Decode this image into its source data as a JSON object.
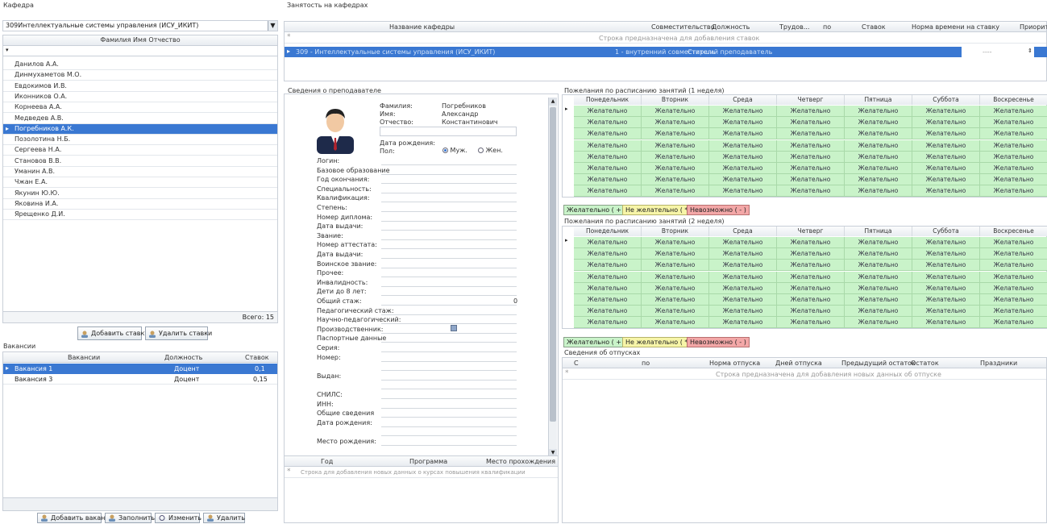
{
  "left": {
    "kafedra_title": "Кафедра",
    "kafedra_value": "309Интеллектуальные системы управления (ИСУ_ИКИТ)",
    "fio_header": "Фамилия Имя Отчество",
    "teachers": [
      "Данилов А.А.",
      "Динмухаметов М.О.",
      "Евдокимов И.В.",
      "Иконников О.А.",
      "Корнеева А.А.",
      "Медведев А.В.",
      "Погребников А.К.",
      "Позолотина Н.Б.",
      "Сергеева Н.А.",
      "Становов В.В.",
      "Уманин А.В.",
      "Чжан Е.А.",
      "Якунин Ю.Ю.",
      "Яковина И.А.",
      "Ярещенко Д.И."
    ],
    "selected_index": 6,
    "total_label": "Всего: 15",
    "add_rate_btn": "Добавить ставку",
    "remove_rate_btn": "Удалить ставки",
    "vacancies_title": "Вакансии",
    "vac_headers": [
      "Вакансии",
      "Должность",
      "Ставок"
    ],
    "vacancies": [
      {
        "name": "Вакансия 1",
        "position": "Доцент",
        "rate": "0,1"
      },
      {
        "name": "Вакансия 3",
        "position": "Доцент",
        "rate": "0,15"
      }
    ],
    "btn_add_vac": "Добавить вакансию",
    "btn_fill": "Заполнить",
    "btn_change": "Изменить",
    "btn_delete": "Удалить"
  },
  "employment": {
    "title": "Занятость на кафедрах",
    "headers": [
      "Название кафедры",
      "Совместительство",
      "Должность",
      "Трудов...",
      "по",
      "Ставок",
      "Норма времени на ставку",
      "Приорите"
    ],
    "add_row_hint": "Строка предназначена для добавления ставок",
    "row": {
      "kafedra": "309 - Интеллектуальные системы управления (ИСУ_ИКИТ)",
      "sovm": "1 - внутренний совместитель",
      "dolzh": "Старший преподаватель",
      "norma": "----"
    }
  },
  "teacher": {
    "title": "Сведения о преподавателе",
    "fam_label": "Фамилия:",
    "fam": "Погребников",
    "name_label": "Имя:",
    "name": "Александр",
    "otch_label": "Отчество:",
    "otch": "Константинович",
    "birth_label": "Дата рождения:",
    "sex_label": "Пол:",
    "male": "Муж.",
    "female": "Жен.",
    "fields": [
      "Логин:",
      "Базовое образование",
      "Год окончания:",
      "Специальность:",
      "Квалификация:",
      "Степень:",
      "Номер диплома:",
      "Дата выдачи:",
      "Звание:",
      "Номер аттестата:",
      "Дата выдачи:",
      "Воинское звание:",
      "Прочее:",
      "Инвалидность:",
      "Дети до 8 лет:",
      "Общий стаж:",
      "Педагогический стаж:",
      "Научно-педагогический:",
      "Производственник:",
      "Паспортные данные",
      "Серия:",
      "Номер:",
      "",
      "Выдан:",
      "",
      "СНИЛС:",
      "ИНН:",
      "Общие сведения",
      "Дата рождения:",
      "",
      "Место рождения:"
    ],
    "stazh_value": "0",
    "courses_headers": [
      "Год",
      "Программа",
      "Место прохождения"
    ],
    "courses_hint": "Строка для добавления новых данных о курсах повышения квалификации"
  },
  "schedule1": {
    "title": "Пожелания по расписанию занятий (1 неделя)",
    "days": [
      "Понедельник",
      "Вторник",
      "Среда",
      "Четверг",
      "Пятница",
      "Суббота",
      "Воскресенье"
    ],
    "cell": "Желательно",
    "rows": 8
  },
  "schedule2": {
    "title": "Пожелания по расписанию занятий (2 неделя)",
    "days": [
      "Понедельник",
      "Вторник",
      "Среда",
      "Четверг",
      "Пятница",
      "Суббота",
      "Воскресенье"
    ],
    "cell": "Желательно",
    "rows": 8
  },
  "pref": {
    "good": "Желательно ( + )",
    "notgood": "Не желательно ( * )",
    "impossible": "Невозможно ( - )"
  },
  "vacation": {
    "title": "Сведения об отпусках",
    "headers": [
      "С",
      "по",
      "Норма отпуска",
      "Дней отпуска",
      "Предыдущий остаток",
      "Остаток",
      "Праздники"
    ],
    "hint": "Строка предназначена для добавления новых данных об отпуске"
  },
  "colors": {
    "selection": "#3a78d2",
    "green_cell": "#c9f3c9",
    "good_btn": "#c9f3c9",
    "notgood_btn": "#f7f5a8",
    "impossible_btn": "#f3a7a7"
  }
}
